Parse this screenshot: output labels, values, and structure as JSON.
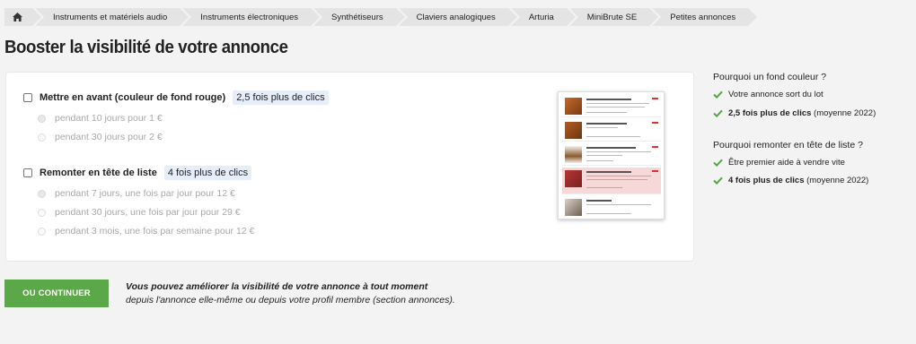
{
  "breadcrumb": [
    "Instruments et matériels audio",
    "Instruments électroniques",
    "Synthétiseurs",
    "Claviers analogiques",
    "Arturia",
    "MiniBrute SE",
    "Petites annonces"
  ],
  "page_title": "Booster la visibilité de votre annonce",
  "options": {
    "highlight": {
      "label": "Mettre en avant (couleur de fond rouge)",
      "badge": "2,5 fois plus de clics",
      "durations": [
        "pendant 10 jours pour 1 €",
        "pendant 30 jours pour 2 €"
      ]
    },
    "bump": {
      "label": "Remonter en tête de liste",
      "badge": "4 fois plus de clics",
      "durations": [
        "pendant 7 jours, une fois par jour pour 12 €",
        "pendant 30 jours, une fois par jour pour 29 €",
        "pendant 3 mois, une fois par semaine pour 12 €"
      ]
    }
  },
  "sidebar": {
    "q1": "Pourquoi un fond couleur ?",
    "q1_items": [
      {
        "bold": "",
        "text": "Votre annonce sort du lot"
      },
      {
        "bold": "2,5 fois plus de clics",
        "text": " (moyenne 2022)"
      }
    ],
    "q2": "Pourquoi remonter en tête de liste ?",
    "q2_items": [
      {
        "bold": "",
        "text": "Être premier aide à vendre vite"
      },
      {
        "bold": "4 fois plus de clics",
        "text": " (moyenne 2022)"
      }
    ]
  },
  "footer": {
    "button": "OU CONTINUER",
    "note_bold": "Vous pouvez améliorer la visibilité de votre annonce à tout moment",
    "note": "depuis l'annonce elle-même ou depuis votre profil membre (section annonces)."
  },
  "colors": {
    "accent_green": "#5aa847",
    "badge_bg": "#e6eefb",
    "highlight_row": "#f7d8d8"
  },
  "icons": {
    "home": "home-icon",
    "check": "check-icon"
  }
}
